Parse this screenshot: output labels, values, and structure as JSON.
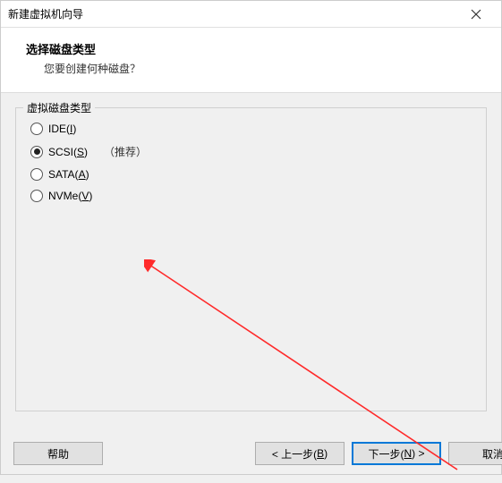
{
  "title": "新建虚拟机向导",
  "heading": "选择磁盘类型",
  "subheading": "您要创建何种磁盘？",
  "group_label": "虚拟磁盘类型",
  "options": {
    "ide": {
      "prefix": "IDE(",
      "u": "I",
      "suffix": ")"
    },
    "scsi": {
      "prefix": "SCSI(",
      "u": "S",
      "suffix": ")"
    },
    "sata": {
      "prefix": "SATA(",
      "u": "A",
      "suffix": ")"
    },
    "nvme": {
      "prefix": "NVMe(",
      "u": "V",
      "suffix": ")"
    }
  },
  "recommended": "（推荐）",
  "buttons": {
    "help": "帮助",
    "back_pre": "< 上一步(",
    "back_u": "B",
    "back_suf": ")",
    "next_pre": "下一步(",
    "next_u": "N",
    "next_suf": ") >",
    "cancel": "取消"
  }
}
